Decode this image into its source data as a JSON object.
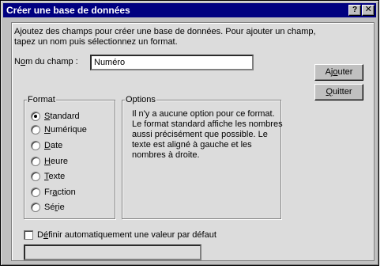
{
  "window": {
    "title": "Créer une base de données",
    "help_label": "?",
    "close_label": "✕"
  },
  "intro": {
    "line1": "Ajoutez des champs pour créer une base de données. Pour ajouter un champ,",
    "line2": "tapez un nom puis sélectionnez un format."
  },
  "field": {
    "label_u": "N",
    "label_u_char": "o",
    "label_rest": "m du champ :",
    "value": "Numéro"
  },
  "buttons": {
    "ajouter_pre": "Aj",
    "ajouter_u": "o",
    "ajouter_post": "uter",
    "quitter_u": "Q",
    "quitter_post": "uitter"
  },
  "format": {
    "legend": "Format",
    "options": [
      {
        "pre": "",
        "u": "S",
        "post": "tandard",
        "checked": true
      },
      {
        "pre": "",
        "u": "N",
        "post": "umérique",
        "checked": false
      },
      {
        "pre": "",
        "u": "D",
        "post": "ate",
        "checked": false
      },
      {
        "pre": "",
        "u": "H",
        "post": "eure",
        "checked": false
      },
      {
        "pre": "",
        "u": "T",
        "post": "exte",
        "checked": false
      },
      {
        "pre": "Fr",
        "u": "a",
        "post": "ction",
        "checked": false
      },
      {
        "pre": "Sé",
        "u": "r",
        "post": "ie",
        "checked": false
      }
    ]
  },
  "options": {
    "legend": "Options",
    "lines": [
      "Il n'y a aucune option pour ce format.",
      "Le format standard affiche les nombres",
      "aussi précisément que possible. Le",
      "texte est aligné à gauche et les",
      "nombres à droite."
    ]
  },
  "auto_default": {
    "pre": "D",
    "u": "é",
    "post": "finir automatiquement une valeur par défaut",
    "checked": false
  },
  "status_value": ""
}
